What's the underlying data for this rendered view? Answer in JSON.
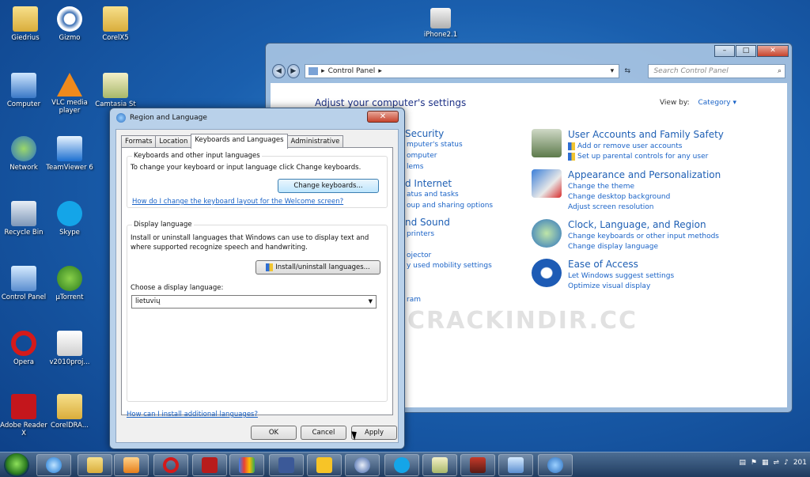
{
  "desktop": {
    "icons": [
      "Giedrius",
      "Gizmo",
      "CorelX5",
      "Computer",
      "VLC media player",
      "Camtasia St",
      "Network",
      "TeamViewer 6",
      "Recycle Bin",
      "Skype",
      "Control Panel",
      "µTorrent",
      "Opera",
      "v2010proj...",
      "Adobe Reader X",
      "CorelDRA..."
    ],
    "top_icon": "iPhone2.1"
  },
  "control_panel": {
    "breadcrumb": "Control Panel",
    "search_placeholder": "Search Control Panel",
    "heading": "Adjust your computer's settings",
    "view_by_label": "View by:",
    "view_by_value": "Category",
    "partial_titles": [
      "Security",
      "d Internet",
      "nd Sound"
    ],
    "partial_links": [
      "mputer's status",
      "omputer",
      "lems",
      "atus and tasks",
      "oup and sharing options",
      "printers",
      "ojector",
      "y used mobility settings",
      "ram"
    ],
    "categories": [
      {
        "title": "User Accounts and Family Safety",
        "links": [
          "Add or remove user accounts",
          "Set up parental controls for any user"
        ]
      },
      {
        "title": "Appearance and Personalization",
        "links": [
          "Change the theme",
          "Change desktop background",
          "Adjust screen resolution"
        ]
      },
      {
        "title": "Clock, Language, and Region",
        "links": [
          "Change keyboards or other input methods",
          "Change display language"
        ]
      },
      {
        "title": "Ease of Access",
        "links": [
          "Let Windows suggest settings",
          "Optimize visual display"
        ]
      }
    ]
  },
  "watermark": "CRACKINDIR.CC",
  "dialog": {
    "title": "Region and Language",
    "tabs": [
      "Formats",
      "Location",
      "Keyboards and Languages",
      "Administrative"
    ],
    "group1_label": "Keyboards and other input languages",
    "group1_text": "To change your keyboard or input language click Change keyboards.",
    "change_keyboards_button": "Change keyboards...",
    "keyboard_link": "How do I change the keyboard layout for the Welcome screen?",
    "group2_label": "Display language",
    "group2_text": "Install or uninstall languages that Windows can use to display text and where supported recognize speech and handwriting.",
    "install_button": "Install/uninstall languages...",
    "choose_label": "Choose a display language:",
    "selected_language": "lietuvių",
    "bottom_link": "How can I install additional languages?",
    "ok": "OK",
    "cancel": "Cancel",
    "apply": "Apply"
  },
  "taskbar": {
    "clock": "201"
  }
}
